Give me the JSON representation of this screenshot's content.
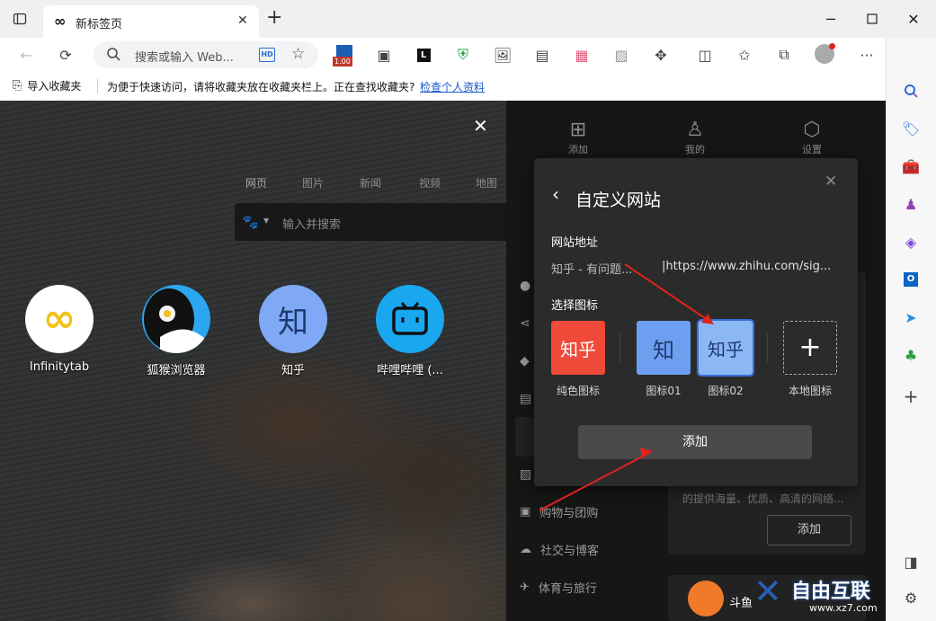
{
  "browser": {
    "tab_title": "新标签页",
    "address_placeholder": "搜索或输入 Web...",
    "badge_value": "1.00"
  },
  "favorites_bar": {
    "import_label": "导入收藏夹",
    "hint_text": "为便于快速访问，请将收藏夹放在收藏夹栏上。正在查找收藏夹?",
    "link_text": "检查个人资料"
  },
  "overlay": {
    "search_tabs": [
      "网页",
      "图片",
      "新闻",
      "视频",
      "地图"
    ],
    "search_placeholder": "输入并搜索",
    "shortcuts": [
      {
        "label": "Infinitytab"
      },
      {
        "label": "狐猴浏览器"
      },
      {
        "label": "知乎",
        "glyph": "知"
      },
      {
        "label": "哔哩哔哩 (..."
      }
    ]
  },
  "right_panel": {
    "top_icons": [
      {
        "label": "添加",
        "icon": "plus-square-icon"
      },
      {
        "label": "我的",
        "icon": "user-icon"
      },
      {
        "label": "设置",
        "icon": "hexagon-gear-icon"
      }
    ],
    "categories": [
      {
        "label": "购物与团购",
        "icon": "bag-icon"
      },
      {
        "label": "社交与博客",
        "icon": "chat-icon"
      },
      {
        "label": "体育与旅行",
        "icon": "plane-icon"
      }
    ],
    "card_desc": "的提供海量、优质、高清的网络...",
    "card_button": "添加",
    "bottom_item": "斗鱼"
  },
  "dialog": {
    "title": "自定义网站",
    "url_section": "网站地址",
    "site_name": "知乎 - 有问题...",
    "site_url": "|https://www.zhihu.com/sig...",
    "icon_section": "选择图标",
    "icon_options": [
      {
        "caption": "纯色图标",
        "text": "知乎",
        "bg": "#f04a3a",
        "color": "#ffffff"
      },
      {
        "caption": "图标01",
        "text": "知",
        "bg": "#6e9ef0",
        "color": "#1d3b6e"
      },
      {
        "caption": "图标02",
        "text": "知乎",
        "bg": "#8cb7f5",
        "color": "#1d3b6e"
      },
      {
        "caption": "本地图标",
        "text": "+",
        "bg": "transparent",
        "color": "#ffffff"
      }
    ],
    "submit_label": "添加"
  },
  "watermark": {
    "text": "自由互联",
    "url": "www.xz7.com"
  },
  "colors": {
    "accent": "#1a73e8",
    "annotation_arrow": "#e0231c",
    "dialog_bg": "#2b2b2b"
  }
}
